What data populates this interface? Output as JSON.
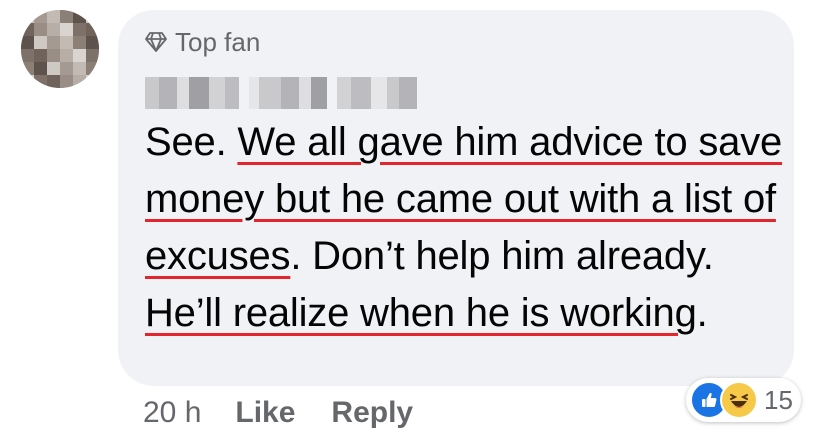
{
  "author": {
    "badge_label": "Top fan",
    "badge_icon": "diamond-icon"
  },
  "comment": {
    "segments": [
      {
        "text": "See. ",
        "underlined": false
      },
      {
        "text": "We all gave him advice to save money but he came out with a list of excuses",
        "underlined": true
      },
      {
        "text": ". Don’t help him already. ",
        "underlined": false
      },
      {
        "text": "He’ll realize when he is working",
        "underlined": true
      },
      {
        "text": ".",
        "underlined": false
      }
    ]
  },
  "meta": {
    "time": "20 h",
    "like_label": "Like",
    "reply_label": "Reply"
  },
  "reactions": {
    "icons": [
      "like-icon",
      "haha-icon"
    ],
    "count": "15"
  },
  "colors": {
    "bubble": "#f0f2f5",
    "text": "#050505",
    "secondary": "#65676b",
    "underline": "#e3262d",
    "like_blue": "#1b74e4",
    "haha_yellow": "#f7c948"
  }
}
